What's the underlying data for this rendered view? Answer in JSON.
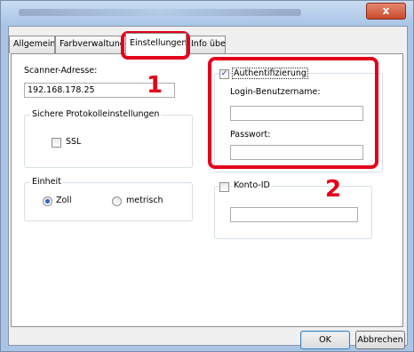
{
  "window": {
    "close_glyph": "x"
  },
  "tabs": [
    {
      "label": "Allgemein",
      "active": false
    },
    {
      "label": "Farbverwaltung",
      "active": false
    },
    {
      "label": "Einstellungen",
      "active": true
    },
    {
      "label": "Info über",
      "active": false
    }
  ],
  "scanner": {
    "label": "Scanner-Adresse:",
    "value": "192.168.178.25"
  },
  "protocol_group": {
    "legend": "Sichere Protokolleinstellungen",
    "ssl_label": "SSL",
    "ssl_checked": false
  },
  "unit_group": {
    "legend": "Einheit",
    "options": [
      {
        "label": "Zoll",
        "selected": true
      },
      {
        "label": "metrisch",
        "selected": false
      }
    ]
  },
  "auth_group": {
    "checkbox_label": "Authentifizierung",
    "checked": true,
    "username_label": "Login-Benutzername:",
    "username_value": "",
    "password_label": "Passwort:",
    "password_value": ""
  },
  "account_group": {
    "checkbox_label": "Konto-ID",
    "checked": false,
    "value": ""
  },
  "markers": {
    "first": "1",
    "second": "2"
  },
  "buttons": {
    "ok": "OK",
    "cancel": "Abbrechen"
  },
  "colors": {
    "highlight": "#e3001b",
    "titlebar": "#a9c4e6",
    "close_button": "#c84a2c"
  }
}
